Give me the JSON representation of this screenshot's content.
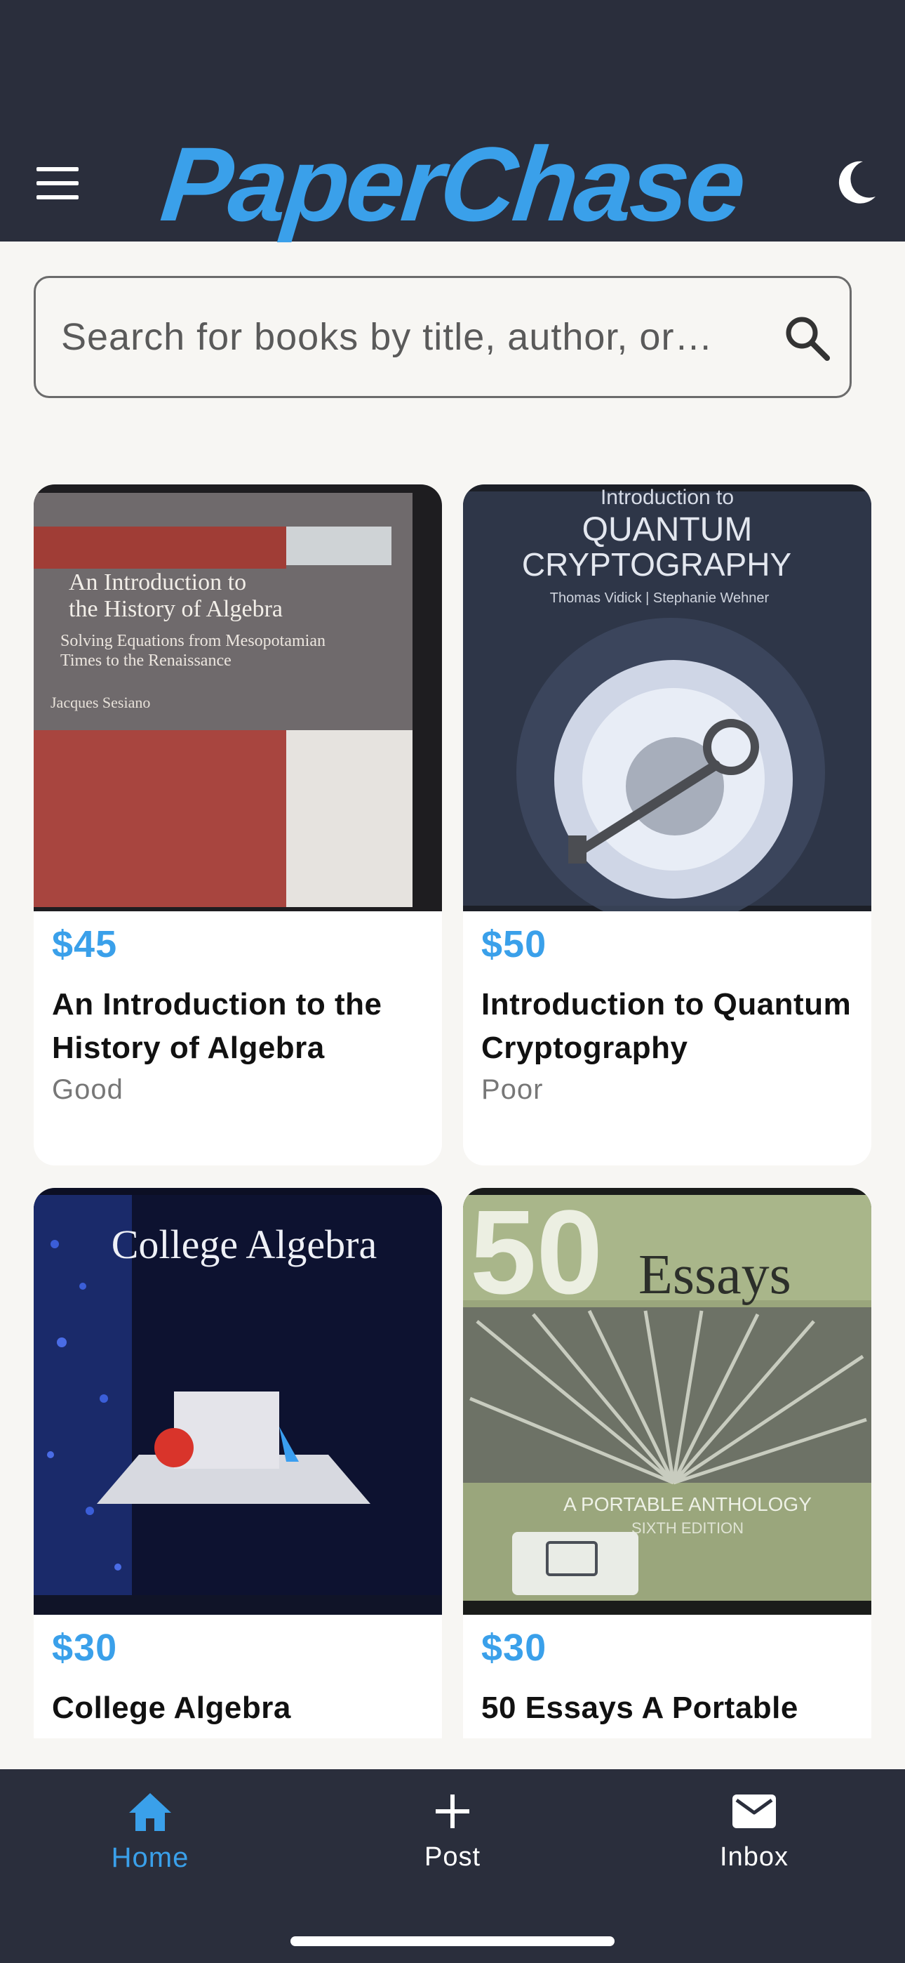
{
  "app": {
    "title": "PaperChase"
  },
  "search": {
    "placeholder": "Search for books by title, author, or…"
  },
  "listings": [
    {
      "price": "$45",
      "title": "An Introduction to the History of Algebra",
      "condition": "Good",
      "cover": {
        "line1": "An Introduction to",
        "line2": "the History of Algebra",
        "sub1": "Solving Equations from Mesopotamian",
        "sub2": "Times to the Renaissance",
        "author": "Jacques Sesiano"
      }
    },
    {
      "price": "$50",
      "title": "Introduction to Quantum Cryptography",
      "condition": "Poor",
      "cover": {
        "line0": "Introduction to",
        "line1": "QUANTUM",
        "line2": "CRYPTOGRAPHY",
        "author": "Thomas Vidick | Stephanie Wehner"
      }
    },
    {
      "price": "$30",
      "title": "College Algebra",
      "condition": "",
      "cover": {
        "line1": "College Algebra"
      }
    },
    {
      "price": "$30",
      "title": "50 Essays A Portable",
      "condition": "",
      "cover": {
        "big": "50",
        "line1": "Essays",
        "sub1": "A PORTABLE ANTHOLOGY",
        "sub2": "SIXTH EDITION"
      }
    }
  ],
  "tabs": [
    {
      "label": "Home",
      "icon": "home-icon",
      "active": true
    },
    {
      "label": "Post",
      "icon": "plus-icon",
      "active": false
    },
    {
      "label": "Inbox",
      "icon": "mail-icon",
      "active": false
    }
  ],
  "colors": {
    "accent": "#3aa0ea",
    "header": "#2a2e3c",
    "background": "#f7f6f3"
  }
}
